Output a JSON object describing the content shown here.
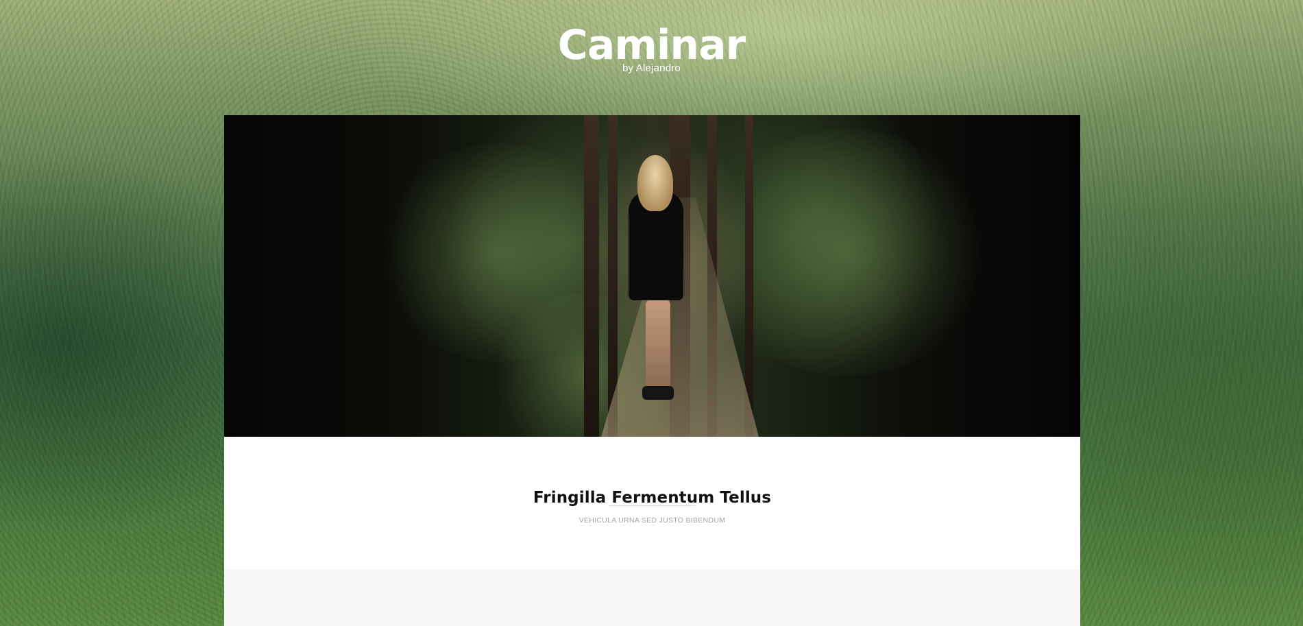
{
  "site": {
    "title": "Caminar",
    "byline": "by Alejandro"
  },
  "post": {
    "title": "Fringilla Fermentum Tellus",
    "subtitle": "VEHICULA URNA SED JUSTO BIBENDUM",
    "image_alt": "Woman walking on a forest path"
  },
  "colors": {
    "title_text": "#ffffff",
    "post_title": "#111111",
    "post_subtitle": "#a3a3a3",
    "card_background": "#ffffff",
    "card_lower_background": "#f6f5f3"
  }
}
